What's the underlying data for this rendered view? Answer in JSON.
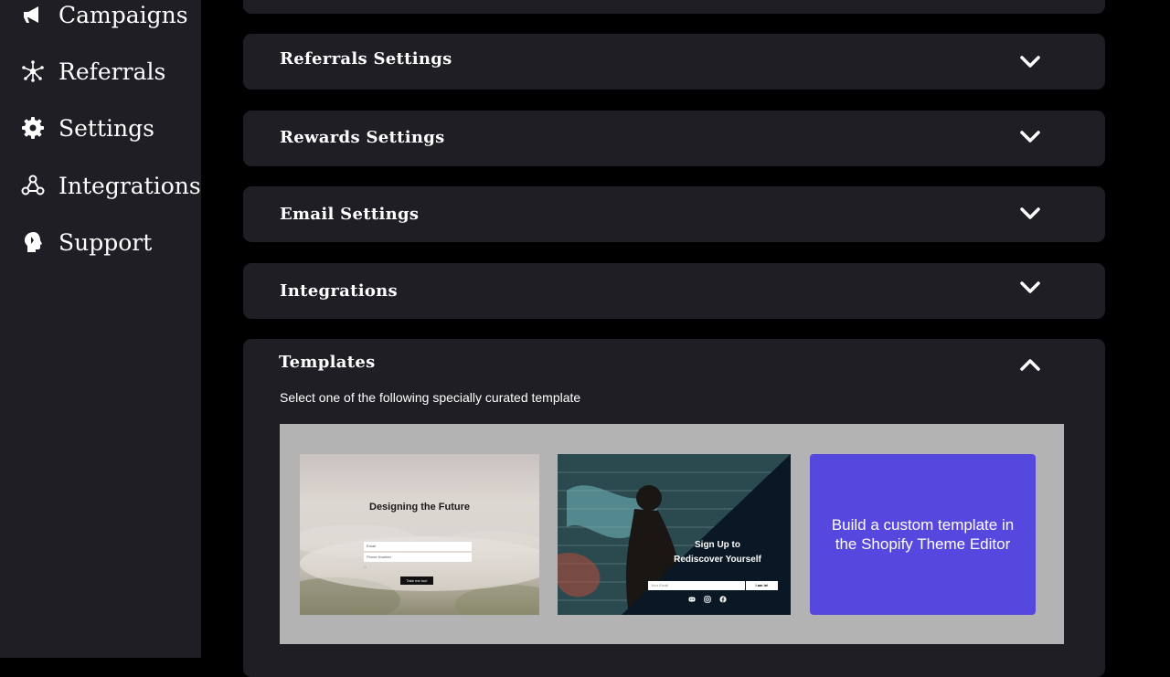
{
  "sidebar": {
    "items": [
      {
        "label": "Campaigns",
        "icon": "megaphone-icon"
      },
      {
        "label": "Referrals",
        "icon": "network-icon"
      },
      {
        "label": "Settings",
        "icon": "gear-icon"
      },
      {
        "label": "Integrations",
        "icon": "webhook-icon"
      },
      {
        "label": "Support",
        "icon": "support-head-icon"
      }
    ]
  },
  "panels": [
    {
      "title": "Referrals Settings",
      "expanded": false
    },
    {
      "title": "Rewards Settings",
      "expanded": false
    },
    {
      "title": "Email Settings",
      "expanded": false
    },
    {
      "title": "Integrations",
      "expanded": false
    },
    {
      "title": "Templates",
      "expanded": true
    }
  ],
  "templates": {
    "subtitle": "Select one of the following specially curated template",
    "card1": {
      "title": "Designing the Future",
      "email_placeholder": "Email",
      "phone_placeholder": "Phone Number",
      "button": "Take me too!"
    },
    "card2": {
      "title_line1": "Sign Up to",
      "title_line2": "Rediscover Yourself",
      "email_placeholder": "Your Email",
      "button": "I am in!"
    },
    "card3": {
      "text": "Build a custom template in the Shopify Theme Editor"
    }
  },
  "colors": {
    "sidebar_bg": "#1f1e24",
    "panel_bg": "#1f1e24",
    "page_bg": "#000000",
    "accent_purple": "#5647df",
    "gallery_bg": "#b3b3b3"
  }
}
